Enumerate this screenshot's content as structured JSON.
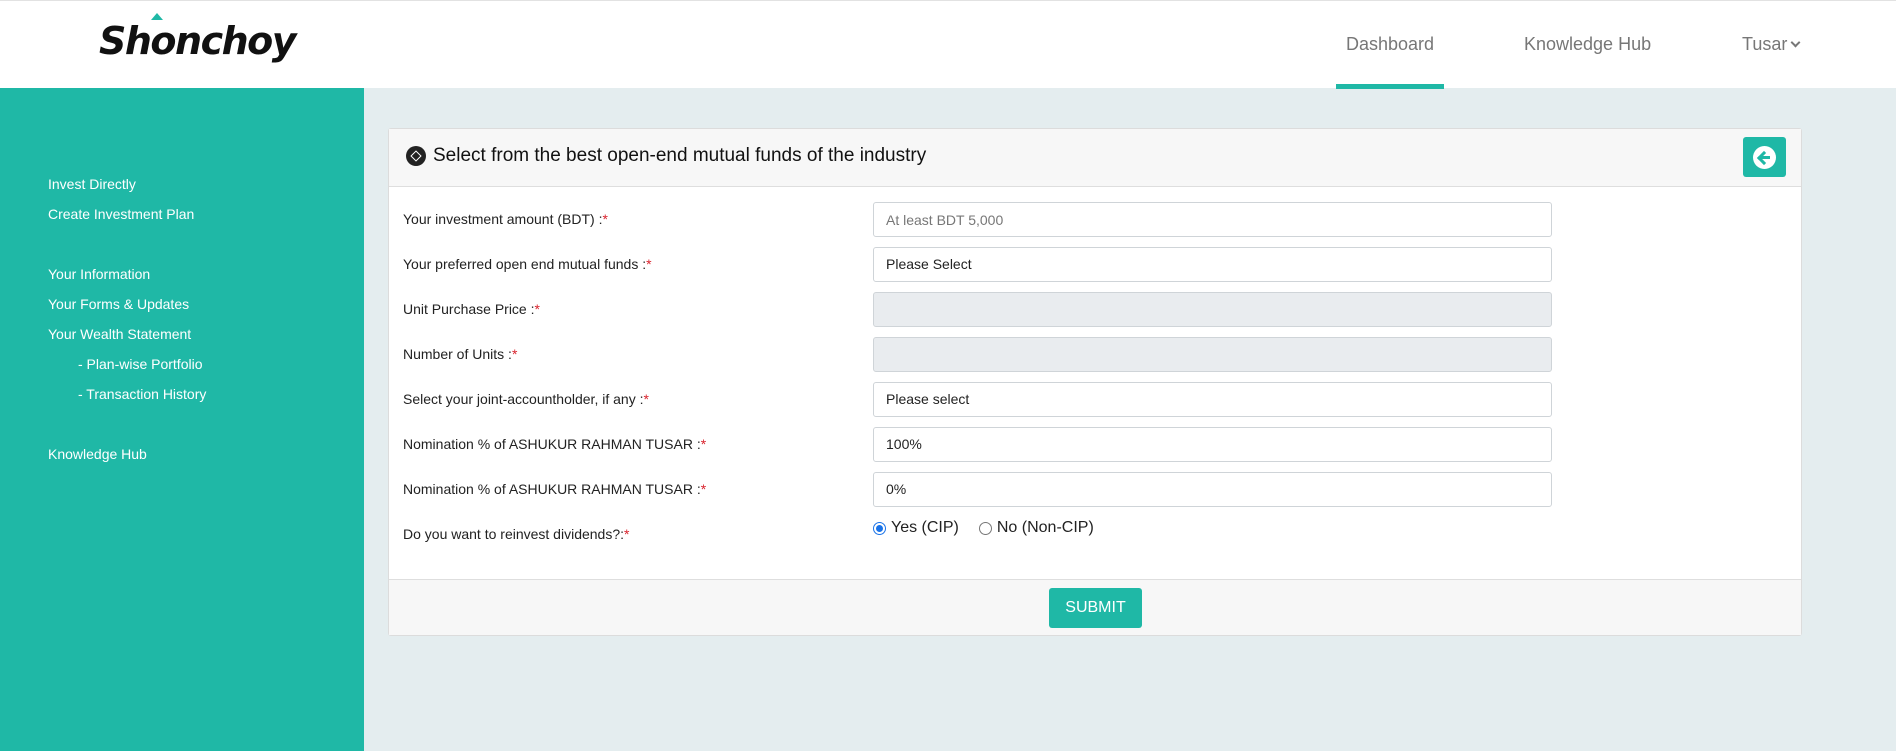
{
  "brand": {
    "logo_text": "Shonchoy",
    "accent_color": "#1fb8a6"
  },
  "nav": {
    "dashboard": "Dashboard",
    "knowledge_hub": "Knowledge Hub",
    "user": "Tusar",
    "active": "Dashboard"
  },
  "sidebar": {
    "items": [
      {
        "label": "Invest Directly"
      },
      {
        "label": "Create Investment Plan"
      },
      {
        "label": "Your Information"
      },
      {
        "label": "Your Forms & Updates"
      },
      {
        "label": "Your Wealth Statement"
      },
      {
        "label": "- Plan-wise Portfolio"
      },
      {
        "label": "- Transaction History"
      },
      {
        "label": "Knowledge Hub"
      }
    ]
  },
  "card": {
    "title": "Select from the best open-end mutual funds of the industry",
    "back_icon": "arrow-left-circle-icon"
  },
  "form": {
    "fields": [
      {
        "label": "Your investment amount (BDT) :",
        "value": "",
        "placeholder": "At least BDT 5,000"
      },
      {
        "label": "Your preferred open end mutual funds :",
        "value": "Please Select"
      },
      {
        "label": "Unit Purchase Price :",
        "value": ""
      },
      {
        "label": "Number of Units :",
        "value": ""
      },
      {
        "label": "Select your joint-accountholder, if any :",
        "value": "Please select"
      },
      {
        "label": "Nomination % of ASHUKUR RAHMAN TUSAR :",
        "value": "100%"
      },
      {
        "label": "Nomination % of ASHUKUR RAHMAN TUSAR :",
        "value": "0%"
      }
    ],
    "reinvest_label": "Do you want to reinvest dividends?:",
    "required_mark": "*",
    "options": [
      {
        "label": "Yes (CIP)",
        "checked": true
      },
      {
        "label": "No (Non-CIP)",
        "checked": false
      }
    ],
    "submit_label": "SUBMIT"
  }
}
